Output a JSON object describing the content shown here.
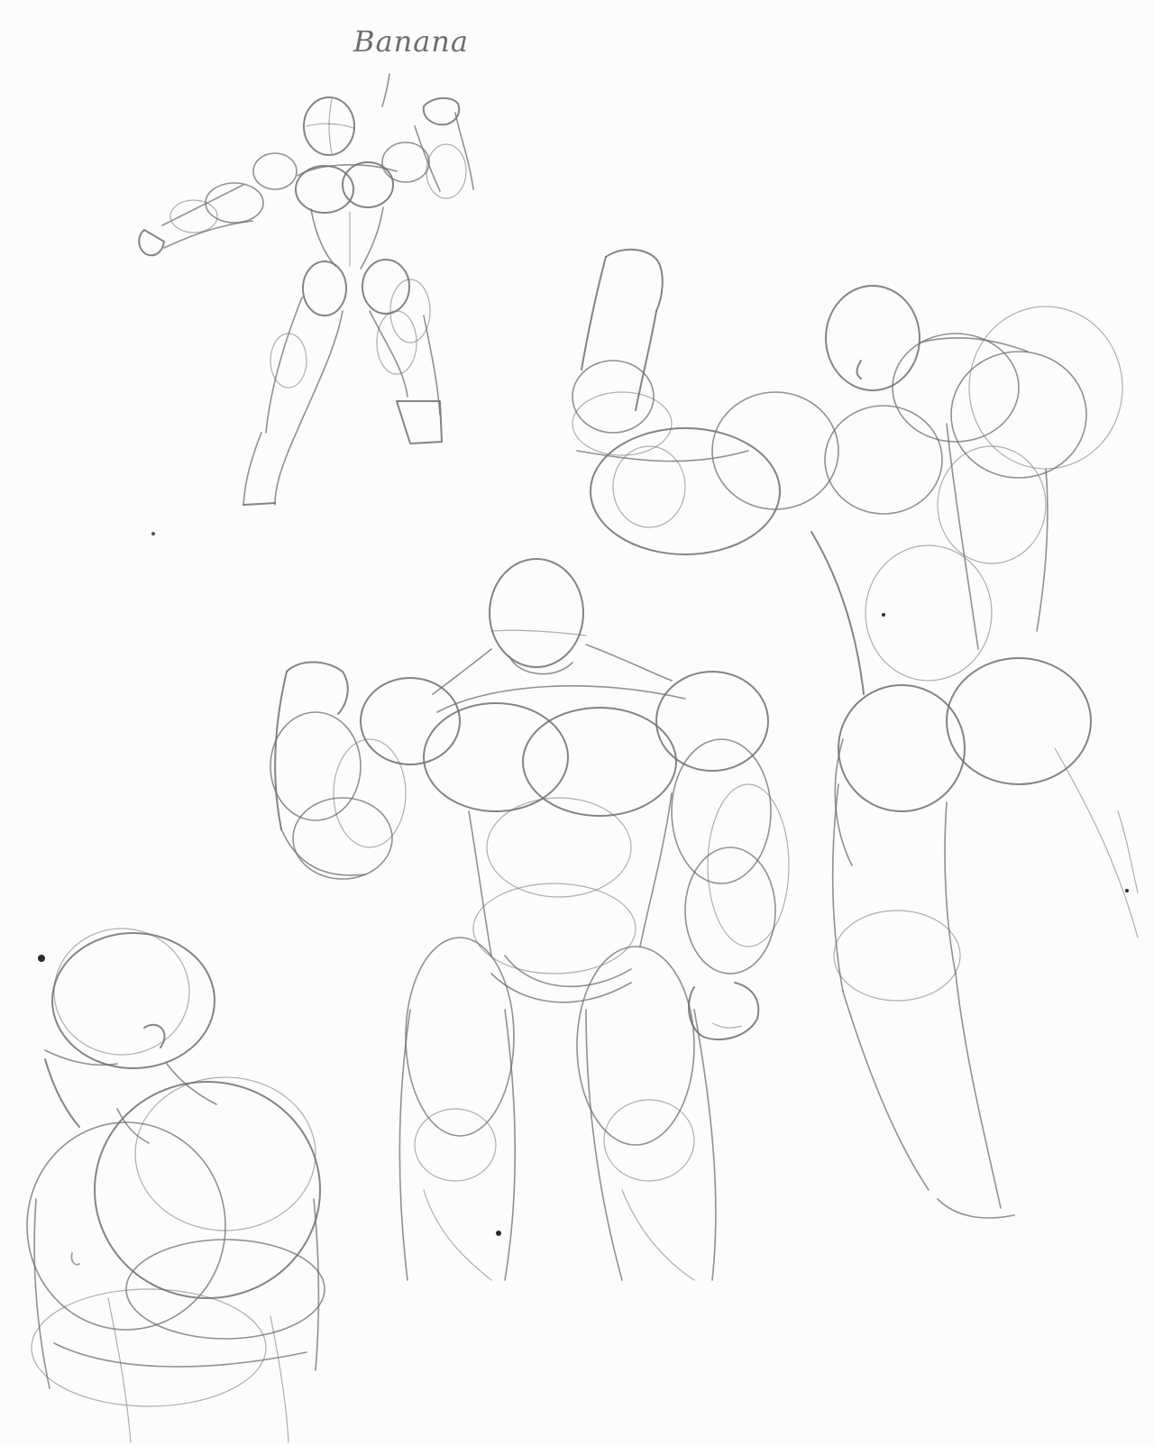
{
  "sheet": {
    "label_text": "Banana",
    "pencil_color": "#6e6e6e",
    "paper_color": "#fcfcfc"
  },
  "figures": [
    {
      "name": "small-flexing-figure"
    },
    {
      "name": "back-view-flexing-figure"
    },
    {
      "name": "front-view-muscular-figure"
    },
    {
      "name": "torso-side-view-figure"
    }
  ]
}
